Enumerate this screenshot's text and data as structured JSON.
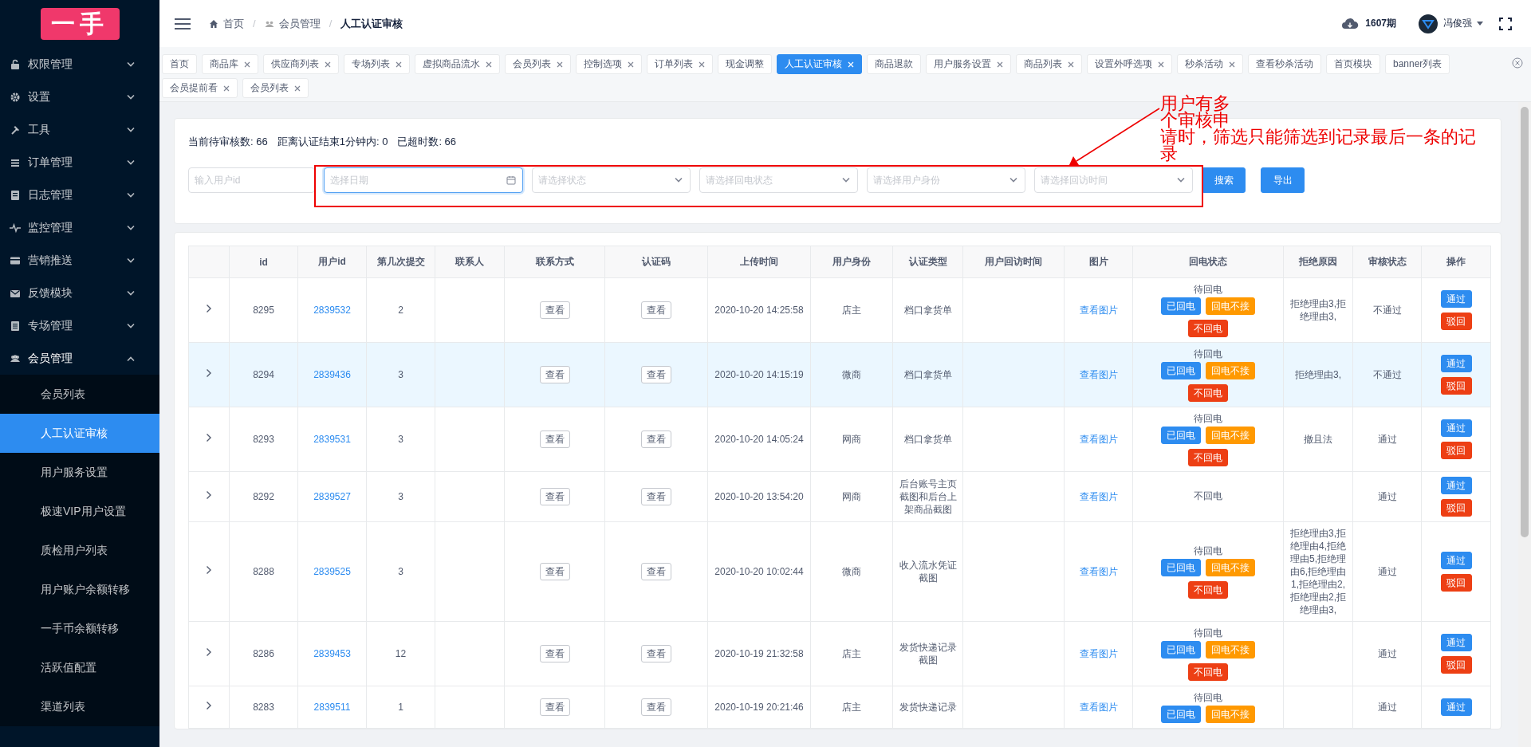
{
  "sidebar": {
    "logo": "一手",
    "items": [
      {
        "label": "权限管理",
        "expanded": false
      },
      {
        "label": "设置",
        "expanded": false
      },
      {
        "label": "工具",
        "expanded": false
      },
      {
        "label": "订单管理",
        "expanded": false
      },
      {
        "label": "日志管理",
        "expanded": false
      },
      {
        "label": "监控管理",
        "expanded": false
      },
      {
        "label": "营销推送",
        "expanded": false
      },
      {
        "label": "反馈模块",
        "expanded": false
      },
      {
        "label": "专场管理",
        "expanded": false
      },
      {
        "label": "会员管理",
        "expanded": true,
        "children": [
          {
            "label": "会员列表",
            "selected": false
          },
          {
            "label": "人工认证审核",
            "selected": true
          },
          {
            "label": "用户服务设置",
            "selected": false
          },
          {
            "label": "极速VIP用户设置",
            "selected": false
          },
          {
            "label": "质检用户列表",
            "selected": false
          },
          {
            "label": "用户账户余额转移",
            "selected": false
          },
          {
            "label": "一手币余额转移",
            "selected": false
          },
          {
            "label": "活跃值配置",
            "selected": false
          },
          {
            "label": "渠道列表",
            "selected": false
          }
        ]
      }
    ]
  },
  "header": {
    "separator": "/",
    "breadcrumb": [
      {
        "label": "首页",
        "current": false
      },
      {
        "label": "会员管理",
        "current": false
      },
      {
        "label": "人工认证审核",
        "current": true
      }
    ],
    "period": "1607期",
    "user": "冯俊强"
  },
  "tabs": [
    {
      "label": "首页",
      "closable": false,
      "selected": false
    },
    {
      "label": "商品库",
      "closable": true,
      "selected": false
    },
    {
      "label": "供应商列表",
      "closable": true,
      "selected": false
    },
    {
      "label": "专场列表",
      "closable": true,
      "selected": false
    },
    {
      "label": "虚拟商品流水",
      "closable": true,
      "selected": false
    },
    {
      "label": "会员列表",
      "closable": true,
      "selected": false
    },
    {
      "label": "控制选项",
      "closable": true,
      "selected": false
    },
    {
      "label": "订单列表",
      "closable": true,
      "selected": false
    },
    {
      "label": "现金调整",
      "closable": false,
      "selected": false
    },
    {
      "label": "人工认证审核",
      "closable": true,
      "selected": true
    },
    {
      "label": "商品退款",
      "closable": false,
      "selected": false
    },
    {
      "label": "用户服务设置",
      "closable": true,
      "selected": false
    },
    {
      "label": "商品列表",
      "closable": true,
      "selected": false
    },
    {
      "label": "设置外呼选项",
      "closable": true,
      "selected": false
    },
    {
      "label": "秒杀活动",
      "closable": true,
      "selected": false
    },
    {
      "label": "查看秒杀活动",
      "closable": false,
      "selected": false
    },
    {
      "label": "首页模块",
      "closable": false,
      "selected": false
    },
    {
      "label": "banner列表",
      "closable": false,
      "selected": false
    },
    {
      "label": "会员提前看",
      "closable": true,
      "selected": false
    },
    {
      "label": "会员列表",
      "closable": true,
      "selected": false
    }
  ],
  "filters": {
    "stats": [
      "当前待审核数: 66",
      "距离认证结束1分钟内: 0",
      "已超时数: 66"
    ],
    "fields": [
      {
        "kind": "input",
        "placeholder": "输入用户id",
        "focused": false
      },
      {
        "kind": "date",
        "placeholder": "选择日期",
        "focused": true
      },
      {
        "kind": "select",
        "placeholder": "请选择状态",
        "focused": false
      },
      {
        "kind": "select",
        "placeholder": "请选择回电状态",
        "focused": false
      },
      {
        "kind": "select",
        "placeholder": "请选择用户身份",
        "focused": false
      },
      {
        "kind": "select",
        "placeholder": "请选择回访时间",
        "focused": false
      }
    ],
    "buttons": [
      "搜索",
      "导出"
    ]
  },
  "annotation": {
    "lines": [
      "用户有多",
      "个审核申",
      "请时，筛选只能筛选到记录最后一条的记",
      "录"
    ]
  },
  "table": {
    "columns": [
      "id",
      "用户id",
      "第几次提交",
      "联系人",
      "联系方式",
      "认证码",
      "上传时间",
      "用户身份",
      "认证类型",
      "用户回访时间",
      "图片",
      "回电状态",
      "拒绝原因",
      "审核状态",
      "操作"
    ],
    "rows": [
      {
        "highlighted": false,
        "id": "8295",
        "user_id": "2839532",
        "submission": "2",
        "contact": "查看",
        "code": "查看",
        "upload_time": "2020-10-20 14:25:58",
        "identity": "店主",
        "cert_type": "档口拿货单",
        "picture": "查看图片",
        "callback": {
          "status": "待回电",
          "buttons": [
            {
              "label": "已回电",
              "kind": "primary"
            },
            {
              "label": "回电不接",
              "kind": "warning"
            },
            {
              "label": "不回电",
              "kind": "danger"
            }
          ]
        },
        "reject_reason": "拒绝理由3,拒绝理由3,",
        "review_status": "不通过",
        "actions": [
          {
            "label": "通过",
            "kind": "primary"
          },
          {
            "label": "驳回",
            "kind": "danger"
          }
        ]
      },
      {
        "highlighted": true,
        "id": "8294",
        "user_id": "2839436",
        "submission": "3",
        "contact": "查看",
        "code": "查看",
        "upload_time": "2020-10-20 14:15:19",
        "identity": "微商",
        "cert_type": "档口拿货单",
        "picture": "查看图片",
        "callback": {
          "status": "待回电",
          "buttons": [
            {
              "label": "已回电",
              "kind": "primary"
            },
            {
              "label": "回电不接",
              "kind": "warning"
            },
            {
              "label": "不回电",
              "kind": "danger"
            }
          ]
        },
        "reject_reason": "拒绝理由3,",
        "review_status": "不通过",
        "actions": [
          {
            "label": "通过",
            "kind": "primary"
          },
          {
            "label": "驳回",
            "kind": "danger"
          }
        ]
      },
      {
        "highlighted": false,
        "id": "8293",
        "user_id": "2839531",
        "submission": "3",
        "contact": "查看",
        "code": "查看",
        "upload_time": "2020-10-20 14:05:24",
        "identity": "网商",
        "cert_type": "档口拿货单",
        "picture": "查看图片",
        "callback": {
          "status": "待回电",
          "buttons": [
            {
              "label": "已回电",
              "kind": "primary"
            },
            {
              "label": "回电不接",
              "kind": "warning"
            },
            {
              "label": "不回电",
              "kind": "danger"
            }
          ]
        },
        "reject_reason": "撤且法",
        "review_status": "通过",
        "actions": [
          {
            "label": "通过",
            "kind": "primary"
          },
          {
            "label": "驳回",
            "kind": "danger"
          }
        ]
      },
      {
        "highlighted": false,
        "id": "8292",
        "user_id": "2839527",
        "submission": "3",
        "contact": "查看",
        "code": "查看",
        "upload_time": "2020-10-20 13:54:20",
        "identity": "网商",
        "cert_type": "后台账号主页截图和后台上架商品截图",
        "picture": "查看图片",
        "callback": {
          "status": "不回电"
        },
        "review_status": "通过",
        "actions": [
          {
            "label": "通过",
            "kind": "primary"
          },
          {
            "label": "驳回",
            "kind": "danger"
          }
        ]
      },
      {
        "highlighted": false,
        "id": "8288",
        "user_id": "2839525",
        "submission": "3",
        "contact": "查看",
        "code": "查看",
        "upload_time": "2020-10-20 10:02:44",
        "identity": "微商",
        "cert_type": "收入流水凭证截图",
        "picture": "查看图片",
        "callback": {
          "status": "待回电",
          "buttons": [
            {
              "label": "已回电",
              "kind": "primary"
            },
            {
              "label": "回电不接",
              "kind": "warning"
            },
            {
              "label": "不回电",
              "kind": "danger"
            }
          ]
        },
        "reject_reason": "拒绝理由3,拒绝理由4,拒绝理由5,拒绝理由6,拒绝理由1,拒绝理由2,拒绝理由2,拒绝理由3,",
        "review_status": "通过",
        "actions": [
          {
            "label": "通过",
            "kind": "primary"
          },
          {
            "label": "驳回",
            "kind": "danger"
          }
        ]
      },
      {
        "highlighted": false,
        "id": "8286",
        "user_id": "2839453",
        "submission": "12",
        "contact": "查看",
        "code": "查看",
        "upload_time": "2020-10-19 21:32:58",
        "identity": "店主",
        "cert_type": "发货快递记录截图",
        "picture": "查看图片",
        "callback": {
          "status": "待回电",
          "buttons": [
            {
              "label": "已回电",
              "kind": "primary"
            },
            {
              "label": "回电不接",
              "kind": "warning"
            },
            {
              "label": "不回电",
              "kind": "danger"
            }
          ]
        },
        "review_status": "通过",
        "actions": [
          {
            "label": "通过",
            "kind": "primary"
          },
          {
            "label": "驳回",
            "kind": "danger"
          }
        ]
      },
      {
        "highlighted": false,
        "id": "8283",
        "user_id": "2839511",
        "submission": "1",
        "contact": "查看",
        "code": "查看",
        "upload_time": "2020-10-19 20:21:46",
        "identity": "店主",
        "cert_type": "发货快递记录",
        "picture": "查看图片",
        "callback": {
          "status": "待回电",
          "buttons": [
            {
              "label": "已回电",
              "kind": "primary"
            },
            {
              "label": "回电不接",
              "kind": "warning"
            }
          ]
        },
        "review_status": "通过",
        "actions": [
          {
            "label": "通过",
            "kind": "primary"
          }
        ]
      }
    ]
  }
}
